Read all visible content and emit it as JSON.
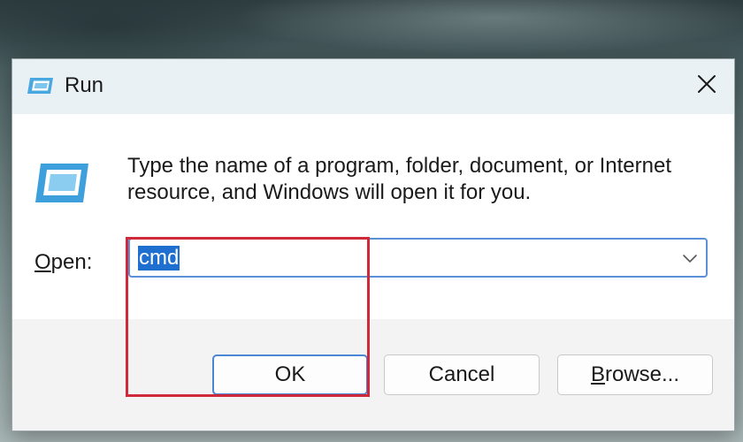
{
  "window": {
    "title": "Run",
    "title_icon": "run-icon",
    "close_icon": "close-icon"
  },
  "content": {
    "description": "Type the name of a program, folder, document, or Internet resource, and Windows will open it for you.",
    "icon": "run-icon"
  },
  "open_field": {
    "label_accel": "O",
    "label_rest": "pen:",
    "value": "cmd",
    "dropdown_icon": "chevron-down-icon"
  },
  "buttons": {
    "ok": "OK",
    "cancel": "Cancel",
    "browse_accel": "B",
    "browse_rest": "rowse..."
  },
  "colors": {
    "selection": "#1f6fd1",
    "focus_border": "#5b8fd8",
    "highlight_annotation": "#d02a3a",
    "titlebar": "#eaf1f5",
    "footer": "#f3f3f3"
  }
}
